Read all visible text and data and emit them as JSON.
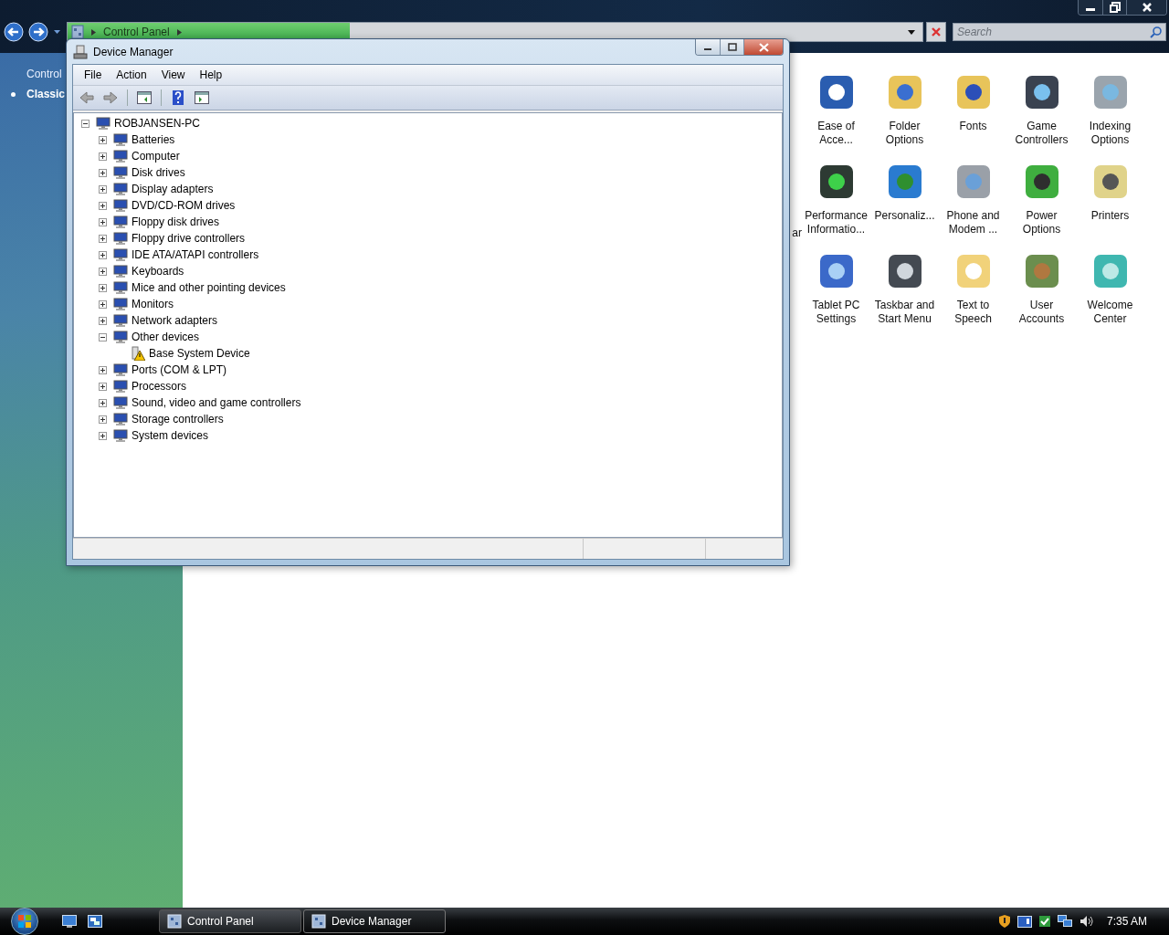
{
  "explorer": {
    "address_bar": {
      "crumbs": [
        "Control Panel"
      ],
      "level": 0.33
    },
    "search": {
      "placeholder": "Search"
    }
  },
  "sidebar": {
    "items": [
      {
        "label": "Control",
        "selected": false
      },
      {
        "label": "Classic",
        "selected": true
      }
    ]
  },
  "applets": {
    "cut_label": "ar",
    "items": [
      {
        "label": "Ease of Acce..."
      },
      {
        "label": "Folder Options"
      },
      {
        "label": "Fonts"
      },
      {
        "label": "Game Controllers"
      },
      {
        "label": "Indexing Options"
      },
      {
        "label": "Performance Informatio..."
      },
      {
        "label": "Personaliz..."
      },
      {
        "label": "Phone and Modem ..."
      },
      {
        "label": "Power Options"
      },
      {
        "label": "Printers"
      },
      {
        "label": "Tablet PC Settings"
      },
      {
        "label": "Taskbar and Start Menu"
      },
      {
        "label": "Text to Speech"
      },
      {
        "label": "User Accounts"
      },
      {
        "label": "Welcome Center"
      }
    ]
  },
  "device_manager": {
    "title": "Device Manager",
    "menu": [
      "File",
      "Action",
      "View",
      "Help"
    ],
    "toolbar": [
      {
        "kind": "back",
        "disabled": true
      },
      {
        "kind": "forward",
        "disabled": true
      },
      {
        "kind": "separator"
      },
      {
        "kind": "console",
        "disabled": false
      },
      {
        "kind": "separator"
      },
      {
        "kind": "help",
        "disabled": false
      },
      {
        "kind": "pane",
        "disabled": false
      }
    ],
    "tree": {
      "label": "ROBJANSEN-PC",
      "expanded": true,
      "children": [
        {
          "label": "Batteries",
          "expanded": false
        },
        {
          "label": "Computer",
          "expanded": false
        },
        {
          "label": "Disk drives",
          "expanded": false
        },
        {
          "label": "Display adapters",
          "expanded": false
        },
        {
          "label": "DVD/CD-ROM drives",
          "expanded": false
        },
        {
          "label": "Floppy disk drives",
          "expanded": false
        },
        {
          "label": "Floppy drive controllers",
          "expanded": false
        },
        {
          "label": "IDE ATA/ATAPI controllers",
          "expanded": false
        },
        {
          "label": "Keyboards",
          "expanded": false
        },
        {
          "label": "Mice and other pointing devices",
          "expanded": false
        },
        {
          "label": "Monitors",
          "expanded": false
        },
        {
          "label": "Network adapters",
          "expanded": false
        },
        {
          "label": "Other devices",
          "expanded": true,
          "children": [
            {
              "label": "Base System Device",
              "warning": true
            }
          ]
        },
        {
          "label": "Ports (COM & LPT)",
          "expanded": false
        },
        {
          "label": "Processors",
          "expanded": false
        },
        {
          "label": "Sound, video and game controllers",
          "expanded": false
        },
        {
          "label": "Storage controllers",
          "expanded": false
        },
        {
          "label": "System devices",
          "expanded": false
        }
      ]
    }
  },
  "taskbar": {
    "tasks": [
      {
        "label": "Control Panel",
        "selected": false
      },
      {
        "label": "Device Manager",
        "selected": true
      }
    ],
    "clock": "7:35 AM"
  }
}
